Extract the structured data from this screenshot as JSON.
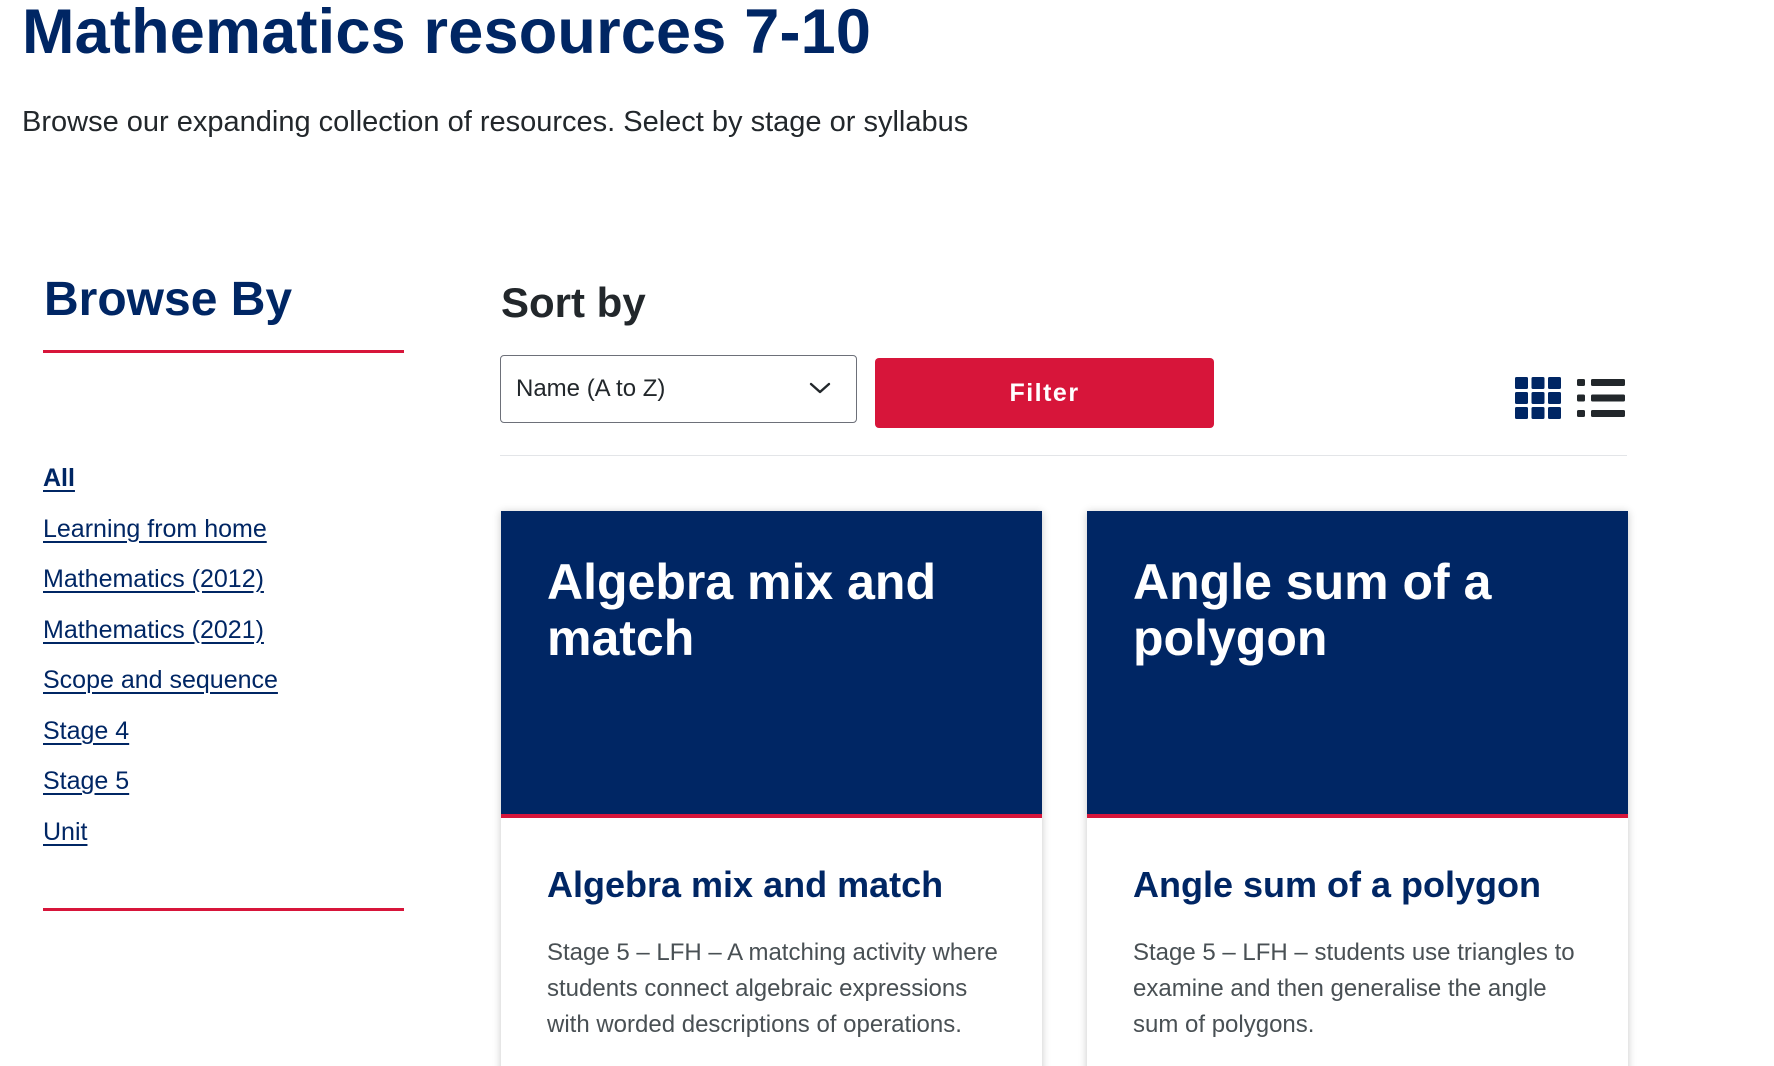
{
  "page": {
    "title": "Mathematics resources 7-10",
    "intro": "Browse our expanding collection of resources. Select by stage or syllabus"
  },
  "sidebar": {
    "heading": "Browse By",
    "items": [
      {
        "label": "All",
        "active": true
      },
      {
        "label": "Learning from home"
      },
      {
        "label": "Mathematics (2012)"
      },
      {
        "label": "Mathematics (2021)"
      },
      {
        "label": "Scope and sequence"
      },
      {
        "label": "Stage 4"
      },
      {
        "label": "Stage 5"
      },
      {
        "label": "Unit"
      }
    ]
  },
  "toolbar": {
    "sort_heading": "Sort by",
    "sort_selected": "Name (A to Z)",
    "filter_label": "Filter",
    "grid_view_icon": "grid-view-icon",
    "list_view_icon": "list-view-icon"
  },
  "cards": [
    {
      "banner_title": "Algebra mix and match",
      "title": "Algebra mix and match",
      "description": "Stage 5 – LFH – A matching activity where students connect algebraic expressions with worded descriptions of operations."
    },
    {
      "banner_title": "Angle sum of a polygon",
      "title": "Angle sum of a polygon",
      "description": "Stage 5 – LFH – students use triangles to examine and then generalise the angle sum of polygons."
    }
  ],
  "colors": {
    "brand_navy": "#002664",
    "accent_red": "#d7153a",
    "text_dark": "#22272b",
    "text_muted": "#495054"
  }
}
